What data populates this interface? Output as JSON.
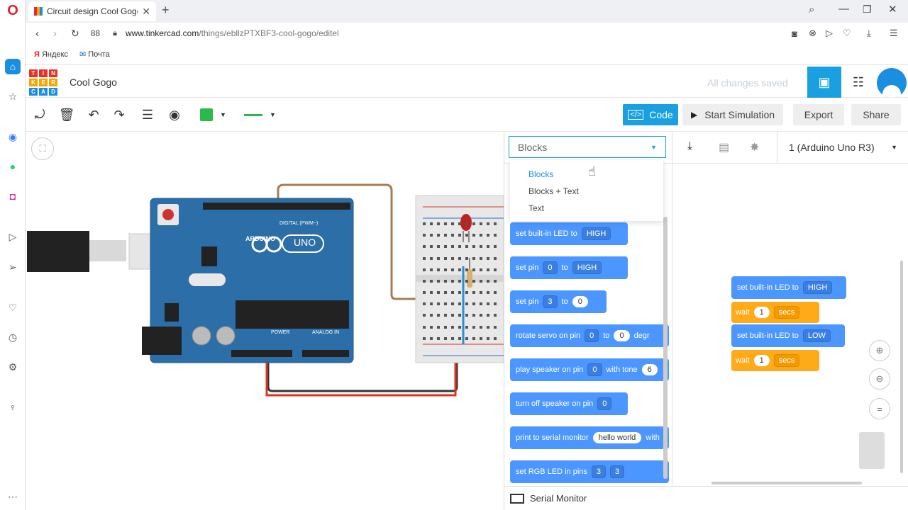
{
  "browser": {
    "tab_title": "Circuit design Cool Gogo |",
    "url_host": "www.tinkercad.com",
    "url_path": "/things/ebllzPTXBF3-cool-gogo/editel",
    "bookmarks": [
      "Яндекс",
      "Почта"
    ]
  },
  "app": {
    "logo_letters": [
      "T",
      "I",
      "N",
      "K",
      "E",
      "R",
      "C",
      "A",
      "D"
    ],
    "design_name": "Cool Gogo",
    "save_status": "All changes saved"
  },
  "toolbar": {
    "code_label": "Code",
    "start_sim_label": "Start Simulation",
    "export_label": "Export",
    "share_label": "Share"
  },
  "code_panel": {
    "mode_selected": "Blocks",
    "mode_options": [
      "Blocks",
      "Blocks + Text",
      "Text"
    ],
    "device": "1 (Arduino Uno R3)",
    "serial_monitor": "Serial Monitor"
  },
  "palette_blocks": [
    {
      "text": "set built-in LED to",
      "dd1": "HIGH"
    },
    {
      "text": "set pin",
      "dd1": "0",
      "mid": "to",
      "dd2": "HIGH"
    },
    {
      "text": "set pin",
      "dd1": "3",
      "mid": "to",
      "pill": "0"
    },
    {
      "text": "rotate servo on pin",
      "dd1": "0",
      "mid": "to",
      "pill": "0",
      "tail": "degr"
    },
    {
      "text": "play speaker on pin",
      "dd1": "0",
      "mid": "with tone",
      "pill": "6"
    },
    {
      "text": "turn off speaker on pin",
      "dd1": "0"
    },
    {
      "text": "print to serial monitor",
      "pill": "hello world",
      "tail": "with"
    },
    {
      "text": "set RGB LED in pins",
      "dd1": "3",
      "dd2": "3"
    }
  ],
  "script": {
    "b1": {
      "text": "set built-in LED to",
      "dd": "HIGH"
    },
    "w1": {
      "text": "wait",
      "val": "1",
      "unit": "secs"
    },
    "b2": {
      "text": "set built-in LED to",
      "dd": "LOW"
    },
    "w2": {
      "text": "wait",
      "val": "1",
      "unit": "secs"
    }
  },
  "board": {
    "brand": "ARDUINO",
    "model": "UNO",
    "digital_label": "DIGITAL (PWM~)",
    "power_label": "POWER",
    "analog_label": "ANALOG IN"
  },
  "colors": {
    "accent": "#1aa0e0",
    "block_blue": "#4c97ff",
    "block_orange": "#ffab19",
    "board_blue": "#2c6fa8"
  }
}
